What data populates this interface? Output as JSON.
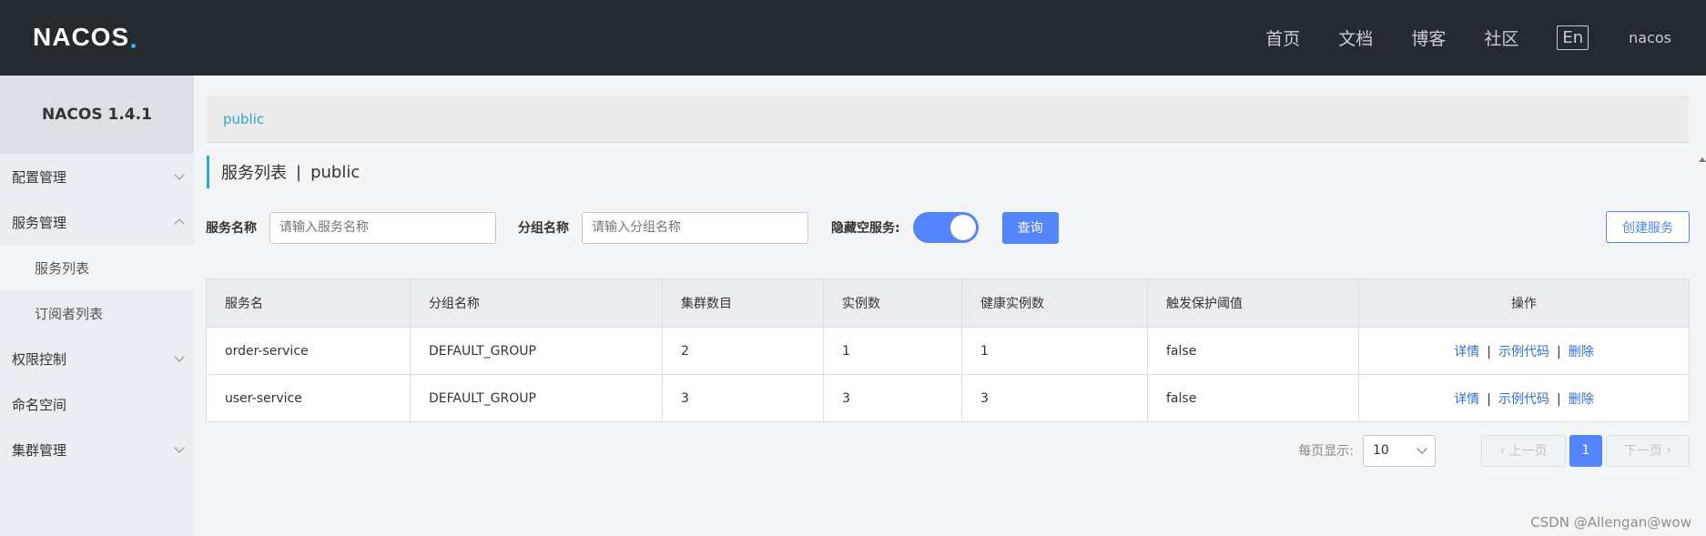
{
  "header": {
    "logo_text": "NACOS",
    "nav": [
      "首页",
      "文档",
      "博客",
      "社区"
    ],
    "lang": "En",
    "user": "nacos"
  },
  "sidebar": {
    "title": "NACOS 1.4.1",
    "items": [
      {
        "label": "配置管理",
        "expanded": false
      },
      {
        "label": "服务管理",
        "expanded": true
      },
      {
        "label": "服务列表"
      },
      {
        "label": "订阅者列表"
      },
      {
        "label": "权限控制",
        "expanded": false
      },
      {
        "label": "命名空间"
      },
      {
        "label": "集群管理",
        "expanded": false
      }
    ]
  },
  "namespace": "public",
  "page_title": {
    "title": "服务列表",
    "separator": "|",
    "namespace": "public"
  },
  "filter": {
    "service_label": "服务名称",
    "service_placeholder": "请输入服务名称",
    "group_label": "分组名称",
    "group_placeholder": "请输入分组名称",
    "hide_empty_label": "隐藏空服务:",
    "hide_empty_on": true,
    "query_label": "查询",
    "create_label": "创建服务"
  },
  "table": {
    "headers": [
      "服务名",
      "分组名称",
      "集群数目",
      "实例数",
      "健康实例数",
      "触发保护阈值",
      "操作"
    ],
    "rows": [
      {
        "name": "order-service",
        "group": "DEFAULT_GROUP",
        "clusters": "2",
        "instances": "1",
        "healthy": "1",
        "threshold": "false"
      },
      {
        "name": "user-service",
        "group": "DEFAULT_GROUP",
        "clusters": "3",
        "instances": "3",
        "healthy": "3",
        "threshold": "false"
      }
    ],
    "actions": {
      "detail": "详情",
      "sample": "示例代码",
      "delete": "删除",
      "sep": "|"
    }
  },
  "pagination": {
    "per_page_label": "每页显示:",
    "per_page": "10",
    "prev": "上一页",
    "current": "1",
    "next": "下一页"
  },
  "watermark": "CSDN @Allengan@wow",
  "colors": {
    "accent": "#5584ff",
    "link": "#2f6fd4",
    "topbar": "#252a2f",
    "namespace": "#2fa5d8"
  }
}
